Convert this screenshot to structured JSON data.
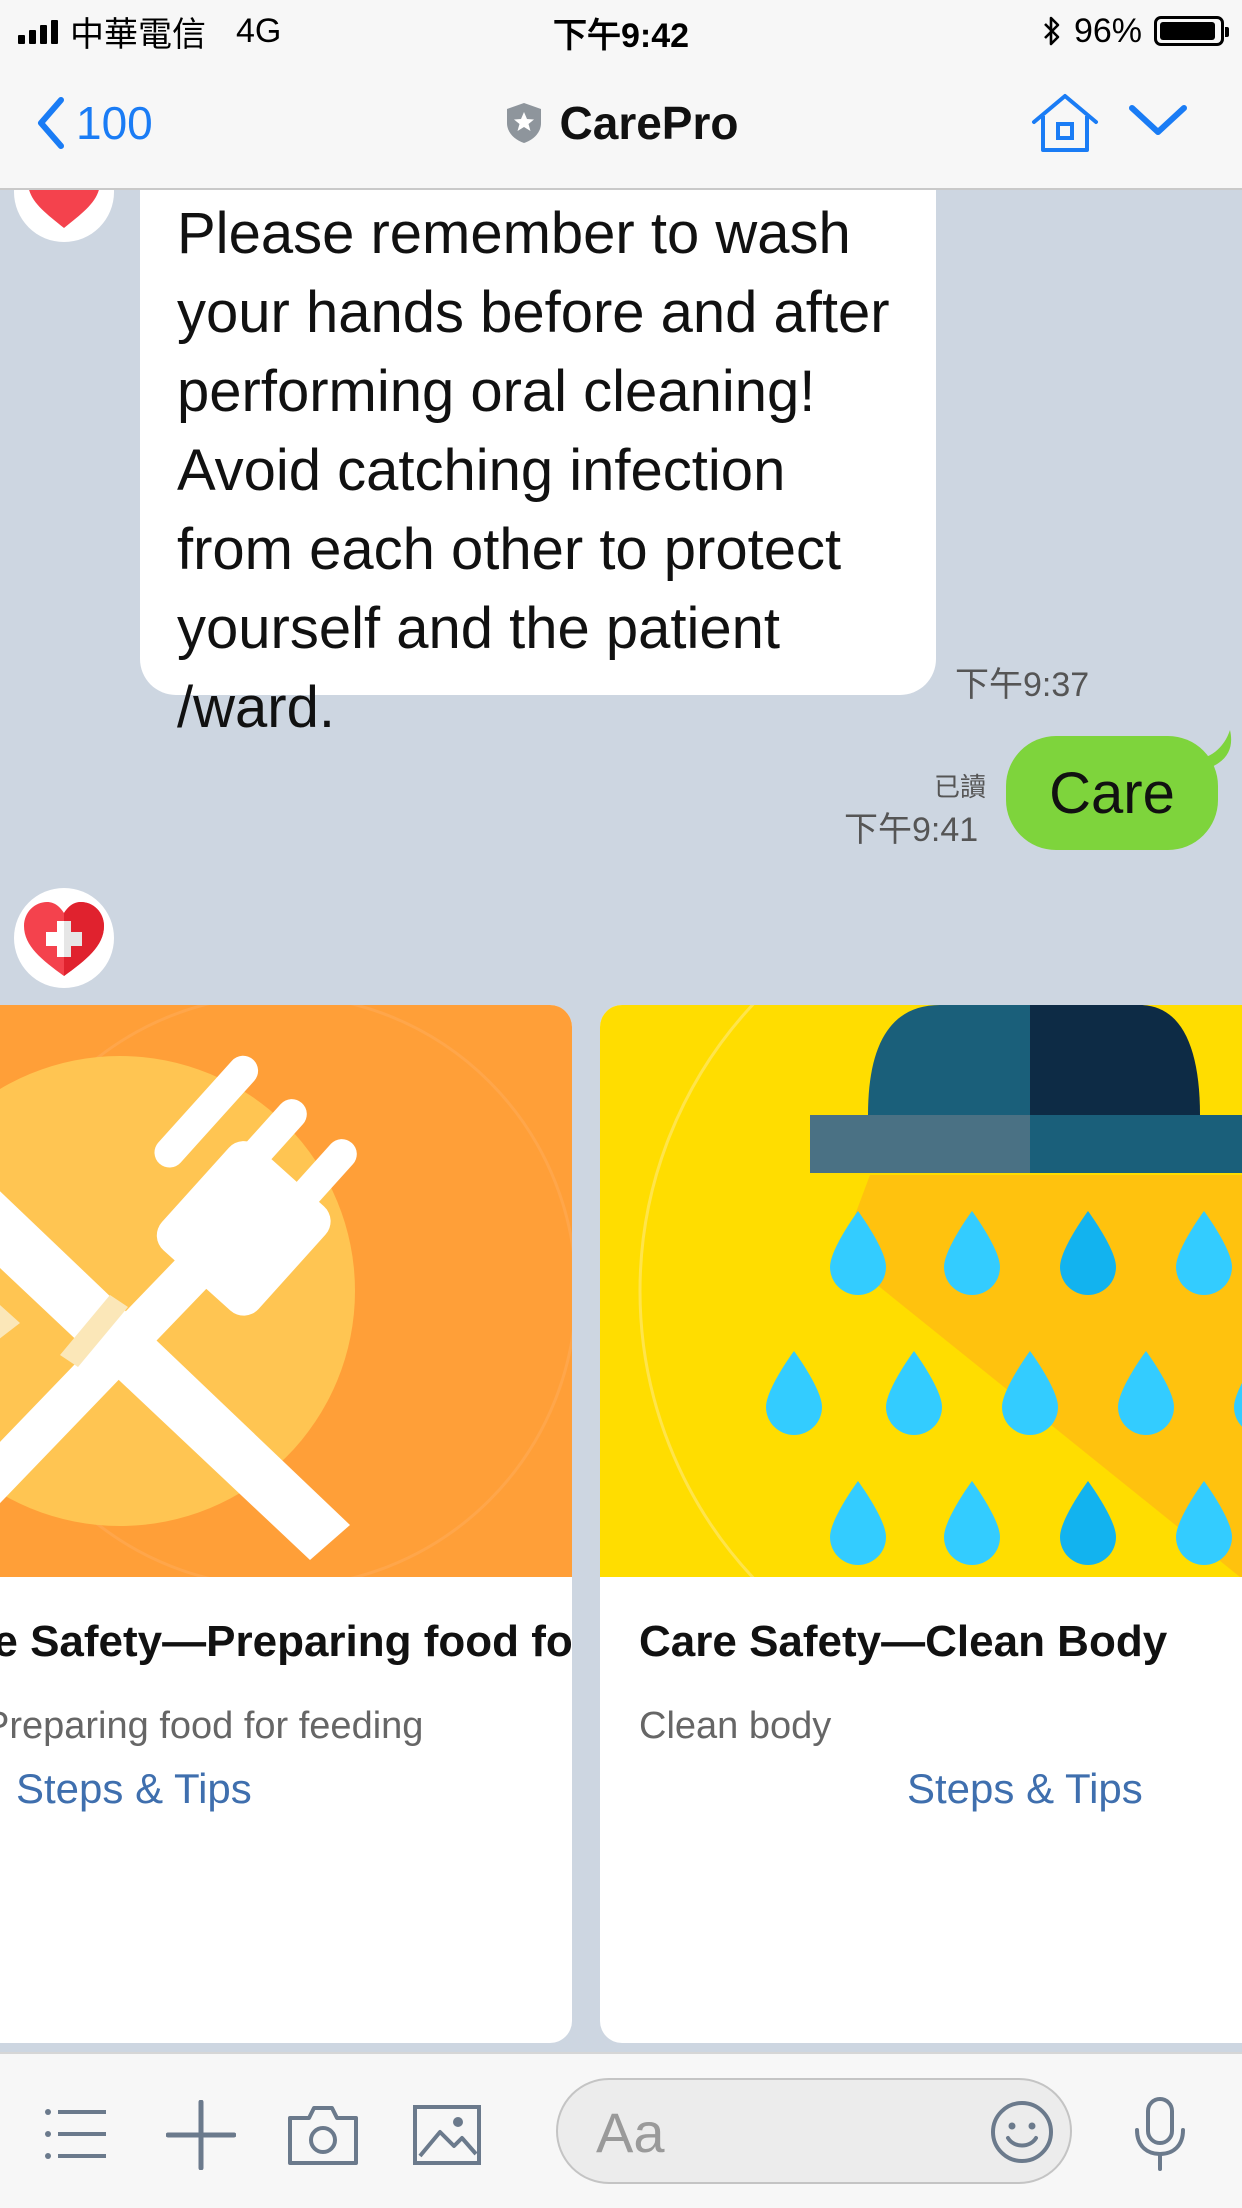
{
  "status_bar": {
    "carrier": "中華電信",
    "network": "4G",
    "time": "下午9:42",
    "battery": "96%"
  },
  "nav": {
    "back_count": "100",
    "title": "CarePro",
    "icons": [
      "chevron-left-icon",
      "shield-star-icon",
      "home-icon",
      "chevron-down-icon"
    ]
  },
  "messages": {
    "incoming_text": "Please remember to wash your hands before and after performing oral cleaning! Avoid catching infection from each other to protect yourself and the patient /ward.",
    "incoming_time": "下午9:37",
    "outgoing_text": "Care",
    "outgoing_read": "已讀",
    "outgoing_time": "下午9:41"
  },
  "cards": [
    {
      "title": "Care Safety—Preparing food for feeding",
      "subtitle": "Preparing food for feeding",
      "action": "Steps & Tips",
      "icon": "fork-knife-icon"
    },
    {
      "title": "Care Safety—Clean Body",
      "subtitle": "Clean body",
      "action": "Steps & Tips",
      "icon": "shower-icon"
    }
  ],
  "input": {
    "placeholder": "Aa",
    "icons": [
      "menu-icon",
      "plus-icon",
      "camera-icon",
      "image-icon",
      "emoji-icon",
      "microphone-icon"
    ]
  },
  "colors": {
    "accent": "#1a7cf5",
    "chat_background": "#cdd6e1",
    "outgoing_bubble": "#7ed43c",
    "link": "#3f6fae",
    "card1_bg": "#ff9f38",
    "card2_bg": "#ffdd00"
  }
}
